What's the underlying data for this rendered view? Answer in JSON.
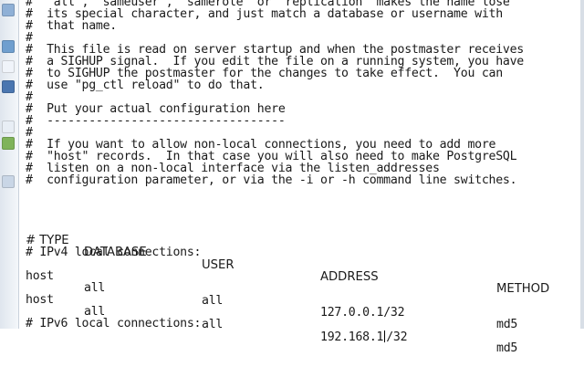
{
  "comment_lines": [
    "#  \"all\", \"sameuser\", \"samerole\" or \"replication\" makes the name lose",
    "#  its special character, and just match a database or username with",
    "#  that name.",
    "#",
    "#  This file is read on server startup and when the postmaster receives",
    "#  a SIGHUP signal.  If you edit the file on a running system, you have",
    "#  to SIGHUP the postmaster for the changes to take effect.  You can",
    "#  use \"pg_ctl reload\" to do that.",
    "#",
    "#  Put your actual configuration here",
    "#  ----------------------------------",
    "#",
    "#  If you want to allow non-local connections, you need to add more",
    "#  \"host\" records.  In that case you will also need to make PostgreSQL",
    "#  listen on a non-local interface via the listen_addresses",
    "#  configuration parameter, or via the -i or -h command line switches."
  ],
  "table_header": {
    "type": "# TYPE",
    "database": "DATABASE",
    "user": "USER",
    "address": "ADDRESS",
    "method": "METHOD"
  },
  "ipv4_comment": "# IPv4 local connections:",
  "rows": [
    {
      "type": "host",
      "database": "all",
      "user": "all",
      "address": "127.0.0.1/32",
      "method": "md5"
    },
    {
      "type": "host",
      "database": "all",
      "user": "all",
      "address_before_caret": "192.168.1",
      "address_after_caret": "/32",
      "method": "md5"
    }
  ],
  "ipv6_comment": "# IPv6 local connections:",
  "colors": {
    "text": "#1a1a1a",
    "background": "#ffffff"
  }
}
